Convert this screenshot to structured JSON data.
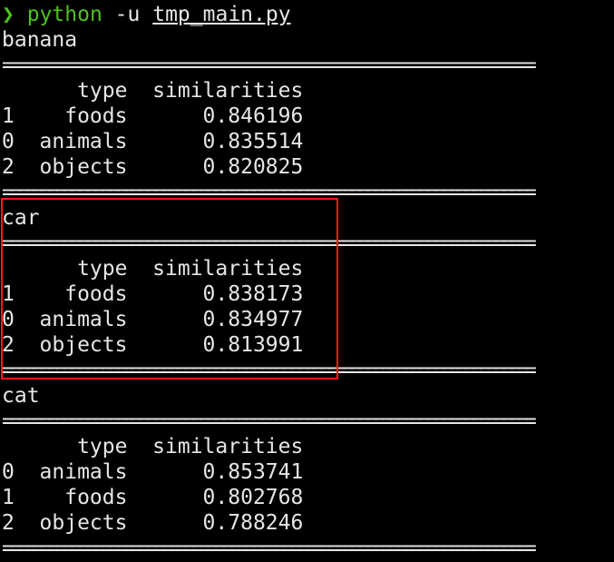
{
  "terminal": {
    "prompt": {
      "arrow": "❯",
      "command": "python",
      "flag": "-u",
      "file": "tmp_main.py"
    },
    "separator": "======================================================================",
    "blocks": [
      {
        "word": "banana",
        "header": "      type  similarities",
        "rows": [
          "1    foods      0.846196",
          "0  animals      0.835514",
          "2  objects      0.820825"
        ]
      },
      {
        "word": "car",
        "header": "      type  similarities",
        "rows": [
          "1    foods      0.838173",
          "0  animals      0.834977",
          "2  objects      0.813991"
        ]
      },
      {
        "word": "cat",
        "header": "      type  similarities",
        "rows": [
          "0  animals      0.853741",
          "1    foods      0.802768",
          "2  objects      0.788246"
        ]
      }
    ]
  },
  "colors": {
    "background": "#000000",
    "text": "#e6e6e6",
    "prompt": "#4ec020",
    "highlight": "#ff1a1a"
  }
}
